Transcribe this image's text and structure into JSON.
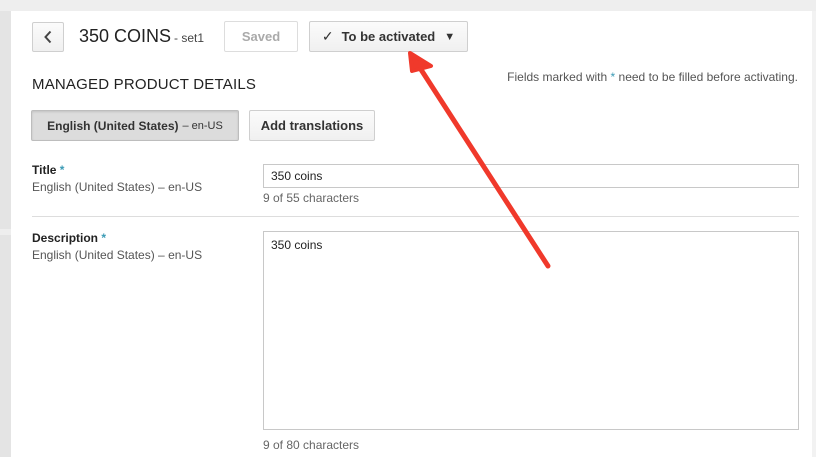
{
  "header": {
    "back_icon": "chevron-left-icon",
    "title": "350 COINS",
    "subtitle": "- set1",
    "saved_label": "Saved",
    "status_check_icon": "check-icon",
    "status_label": "To be activated",
    "status_caret_icon": "caret-down-icon"
  },
  "section": {
    "title": "MANAGED PRODUCT DETAILS",
    "note_before": "Fields marked with ",
    "note_star": "*",
    "note_after": " need to be filled before activating."
  },
  "languages": {
    "selected_name": "English (United States)",
    "selected_code": "– en-US",
    "add_translations_label": "Add translations"
  },
  "fields": {
    "title": {
      "label": "Title",
      "required_marker": "*",
      "language": "English (United States) – en-US",
      "value": "350 coins",
      "counter": "9 of 55 characters"
    },
    "description": {
      "label": "Description",
      "required_marker": "*",
      "language": "English (United States) – en-US",
      "value": "350 coins",
      "counter": "9 of 80 characters"
    }
  },
  "annotation": {
    "arrow_color": "#f0392b"
  }
}
